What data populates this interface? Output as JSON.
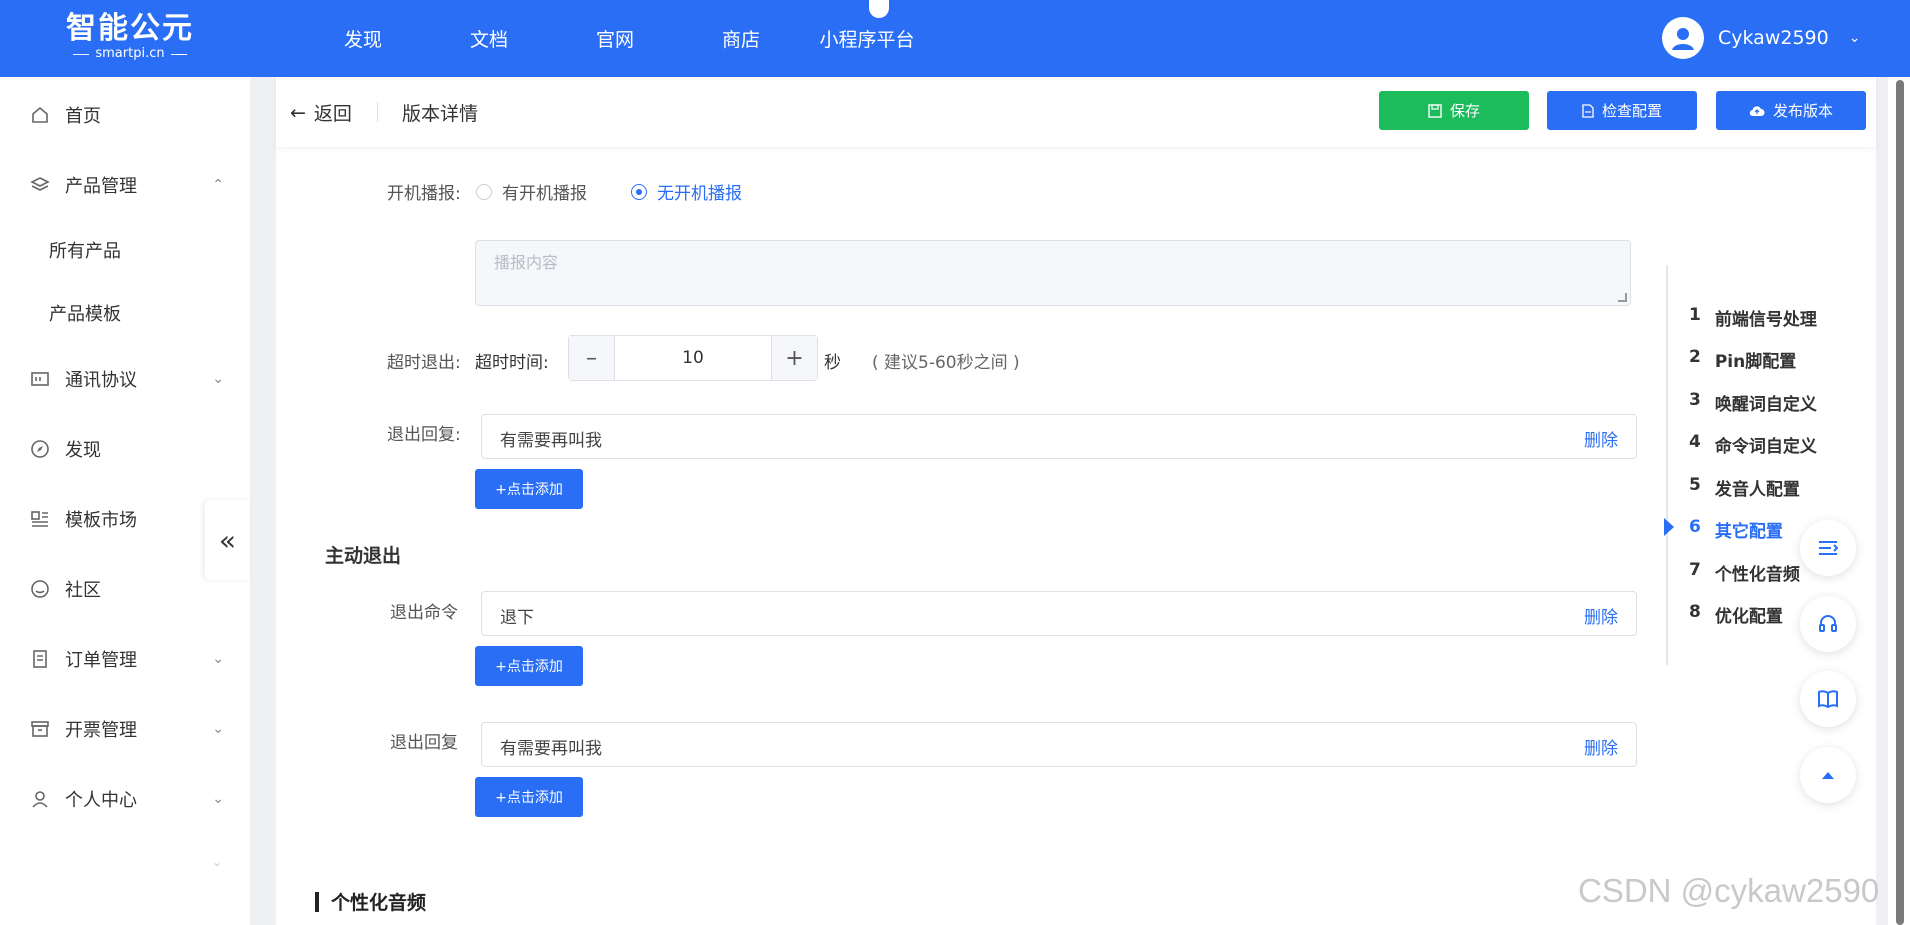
{
  "header": {
    "logo_main": "智能公元",
    "logo_sub": "smartpi.cn",
    "nav": [
      "发现",
      "文档",
      "官网",
      "商店",
      "小程序平台"
    ],
    "username": "Cykaw2590"
  },
  "sidebar": {
    "items": [
      {
        "label": "首页",
        "icon": "home-icon"
      },
      {
        "label": "产品管理",
        "icon": "layers-icon"
      },
      {
        "label": "通讯协议",
        "icon": "protocol-icon"
      },
      {
        "label": "发现",
        "icon": "compass-icon"
      },
      {
        "label": "模板市场",
        "icon": "template-icon"
      },
      {
        "label": "社区",
        "icon": "community-icon"
      },
      {
        "label": "订单管理",
        "icon": "order-icon"
      },
      {
        "label": "开票管理",
        "icon": "invoice-icon"
      },
      {
        "label": "个人中心",
        "icon": "user-icon"
      }
    ],
    "sub_items": [
      "所有产品",
      "产品模板"
    ]
  },
  "subheader": {
    "back": "返回",
    "title": "版本详情",
    "save": "保存",
    "check": "检查配置",
    "publish": "发布版本"
  },
  "form": {
    "boot_label": "开机播报:",
    "boot_opt1": "有开机播报",
    "boot_opt2": "无开机播报",
    "boot_selected": "无开机播报",
    "boot_placeholder": "播报内容",
    "timeout_label": "超时退出:",
    "timeout_sub": "超时时间:",
    "timeout_value": "10",
    "timeout_unit": "秒",
    "timeout_hint": "( 建议5-60秒之间 )",
    "exit_reply_label": "退出回复:",
    "exit_reply_value": "有需要再叫我",
    "delete": "删除",
    "add": "+点击添加",
    "active_exit_title": "主动退出",
    "exit_cmd_label": "退出命令",
    "exit_cmd_value": "退下",
    "exit_reply2_label": "退出回复",
    "exit_reply2_value": "有需要再叫我",
    "bottom_title": "个性化音频"
  },
  "anchor_nav": {
    "items": [
      {
        "num": "1",
        "label": "前端信号处理"
      },
      {
        "num": "2",
        "label": "Pin脚配置"
      },
      {
        "num": "3",
        "label": "唤醒词自定义"
      },
      {
        "num": "4",
        "label": "命令词自定义"
      },
      {
        "num": "5",
        "label": "发音人配置"
      },
      {
        "num": "6",
        "label": "其它配置"
      },
      {
        "num": "7",
        "label": "个性化音频"
      },
      {
        "num": "8",
        "label": "优化配置"
      }
    ],
    "active": "其它配置"
  },
  "watermark": "CSDN @cykaw2590",
  "colors": {
    "primary": "#2a6ef5",
    "success": "#1cbb5c"
  }
}
